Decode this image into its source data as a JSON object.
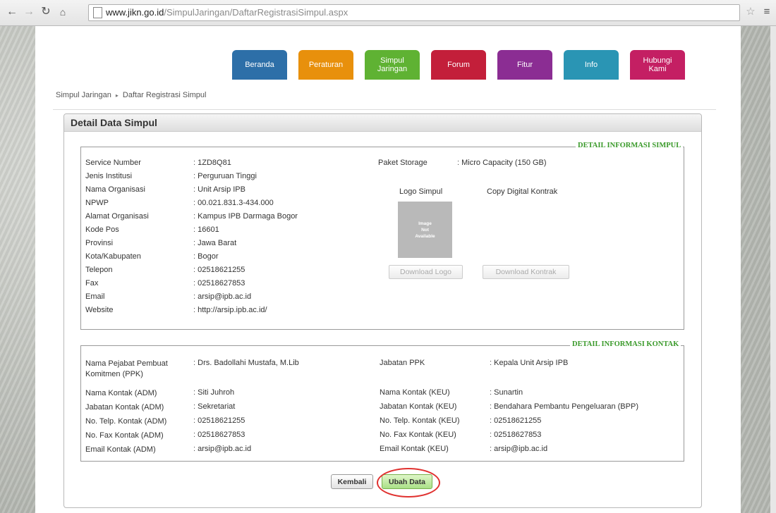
{
  "browser": {
    "url_host": "www.jikn.go.id",
    "url_path": "/SimpulJaringan/DaftarRegistrasiSimpul.aspx"
  },
  "nav_tabs": [
    {
      "label": "Beranda",
      "color": "#2d6fa8"
    },
    {
      "label": "Peraturan",
      "color": "#e8900c"
    },
    {
      "label": "Simpul\nJaringan",
      "color": "#5fb233"
    },
    {
      "label": "Forum",
      "color": "#c31f3a"
    },
    {
      "label": "Fitur",
      "color": "#8b2d93"
    },
    {
      "label": "Info",
      "color": "#2a95b4"
    },
    {
      "label": "Hubungi\nKami",
      "color": "#c41f63"
    }
  ],
  "breadcrumb": {
    "first": "Simpul Jaringan",
    "separator": "▸",
    "second": "Daftar Registrasi Simpul"
  },
  "panel_title": "Detail Data Simpul",
  "simpul": {
    "legend": "DETAIL INFORMASI SIMPUL",
    "fields": [
      {
        "label": "Service Number",
        "value": "1ZD8Q81"
      },
      {
        "label": "Jenis Institusi",
        "value": "Perguruan Tinggi"
      },
      {
        "label": "Nama Organisasi",
        "value": "Unit Arsip IPB"
      },
      {
        "label": "NPWP",
        "value": "00.021.831.3-434.000"
      },
      {
        "label": "Alamat Organisasi",
        "value": "Kampus IPB Darmaga Bogor"
      },
      {
        "label": "Kode Pos",
        "value": "16601"
      },
      {
        "label": "Provinsi",
        "value": "Jawa Barat"
      },
      {
        "label": "Kota/Kabupaten",
        "value": "Bogor"
      },
      {
        "label": "Telepon",
        "value": "02518621255"
      },
      {
        "label": "Fax",
        "value": "02518627853"
      },
      {
        "label": "Email",
        "value": "arsip@ipb.ac.id"
      },
      {
        "label": "Website",
        "value": "http://arsip.ipb.ac.id/"
      }
    ],
    "paket_label": "Paket Storage",
    "paket_value": "Micro Capacity (150 GB)",
    "logo_label": "Logo Simpul",
    "kontrak_label": "Copy Digital Kontrak",
    "image_placeholder": "Image\nNot\nAvailable",
    "download_logo": "Download Logo",
    "download_kontrak": "Download Kontrak"
  },
  "kontak": {
    "legend": "DETAIL INFORMASI KONTAK",
    "left": [
      {
        "label": "Nama Pejabat Pembuat\nKomitmen (PPK)",
        "value": "Drs. Badollahi Mustafa, M.Lib"
      },
      {
        "label": "Nama Kontak (ADM)",
        "value": "Siti Juhroh"
      },
      {
        "label": "Jabatan Kontak (ADM)",
        "value": "Sekretariat"
      },
      {
        "label": "No. Telp. Kontak (ADM)",
        "value": "02518621255"
      },
      {
        "label": "No. Fax Kontak (ADM)",
        "value": "02518627853"
      },
      {
        "label": "Email Kontak (ADM)",
        "value": "arsip@ipb.ac.id"
      }
    ],
    "right": [
      {
        "label": "Jabatan PPK",
        "value": "Kepala Unit Arsip IPB"
      },
      {
        "label": "Nama Kontak (KEU)",
        "value": "Sunartin"
      },
      {
        "label": "Jabatan Kontak (KEU)",
        "value": "Bendahara Pembantu Pengeluaran (BPP)"
      },
      {
        "label": "No. Telp. Kontak (KEU)",
        "value": "02518621255"
      },
      {
        "label": "No. Fax Kontak (KEU)",
        "value": "02518627853"
      },
      {
        "label": "Email Kontak (KEU)",
        "value": "arsip@ipb.ac.id"
      }
    ]
  },
  "buttons": {
    "back": "Kembali",
    "edit": "Ubah Data"
  }
}
